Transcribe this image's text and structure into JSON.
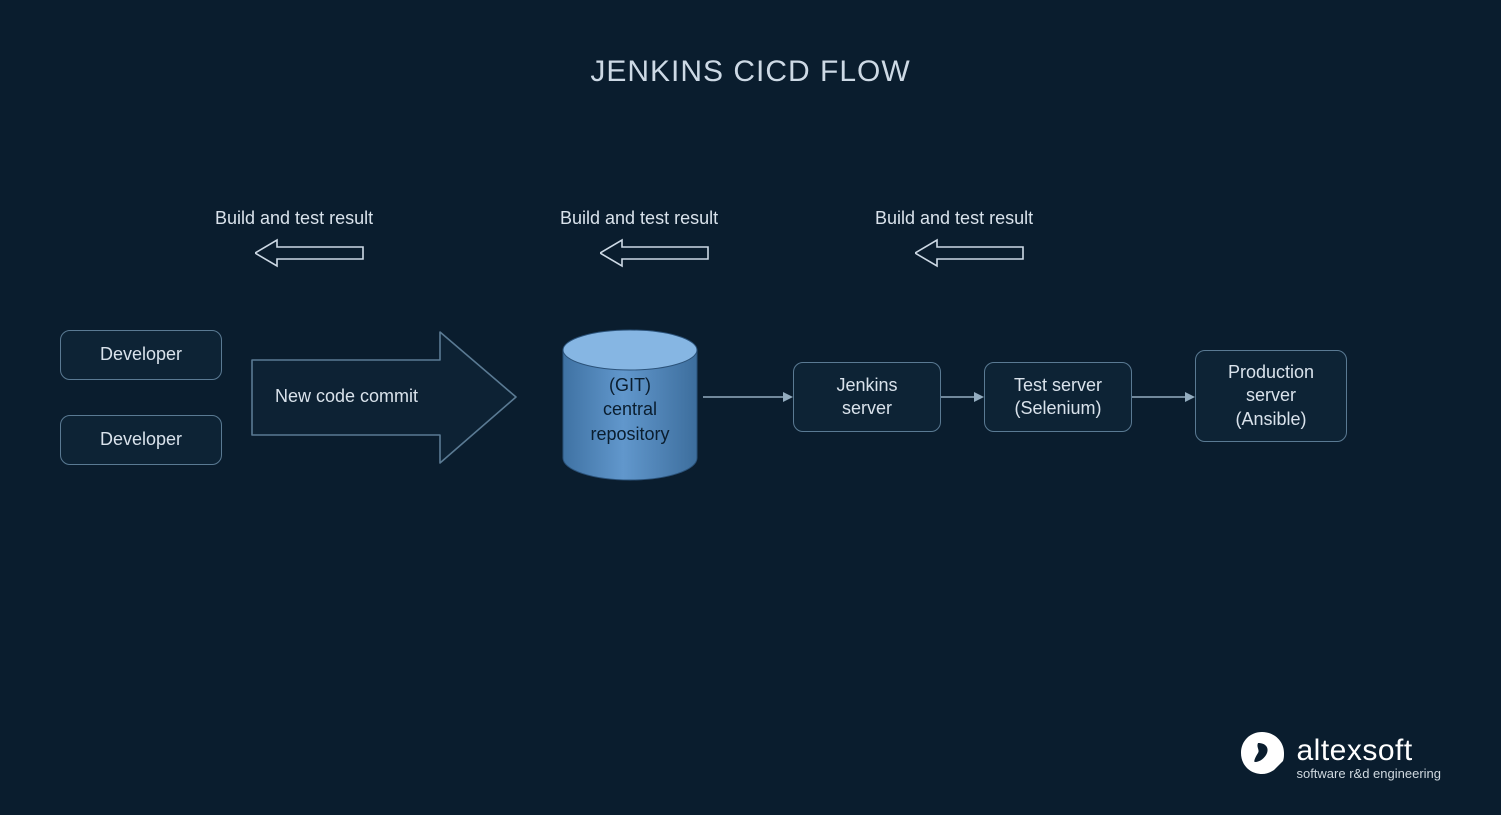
{
  "title": "JENKINS CICD FLOW",
  "feedback": {
    "label1": "Build and test result",
    "label2": "Build and test result",
    "label3": "Build and test result"
  },
  "nodes": {
    "dev1": "Developer",
    "dev2": "Developer",
    "commit_arrow": "New code commit",
    "repo_line1": "(GIT)",
    "repo_line2": "central",
    "repo_line3": "repository",
    "jenkins_line1": "Jenkins",
    "jenkins_line2": "server",
    "test_line1": "Test server",
    "test_line2": "(Selenium)",
    "prod_line1": "Production",
    "prod_line2": "server",
    "prod_line3": "(Ansible)"
  },
  "brand": {
    "name": "altexsoft",
    "tagline": "software r&d engineering"
  },
  "colors": {
    "bg": "#0a1d2e",
    "node_border": "#5a7a93",
    "cylinder_top": "#81b0dd",
    "cylinder_body": "#5b8fc3",
    "text": "#cdd9e5"
  }
}
